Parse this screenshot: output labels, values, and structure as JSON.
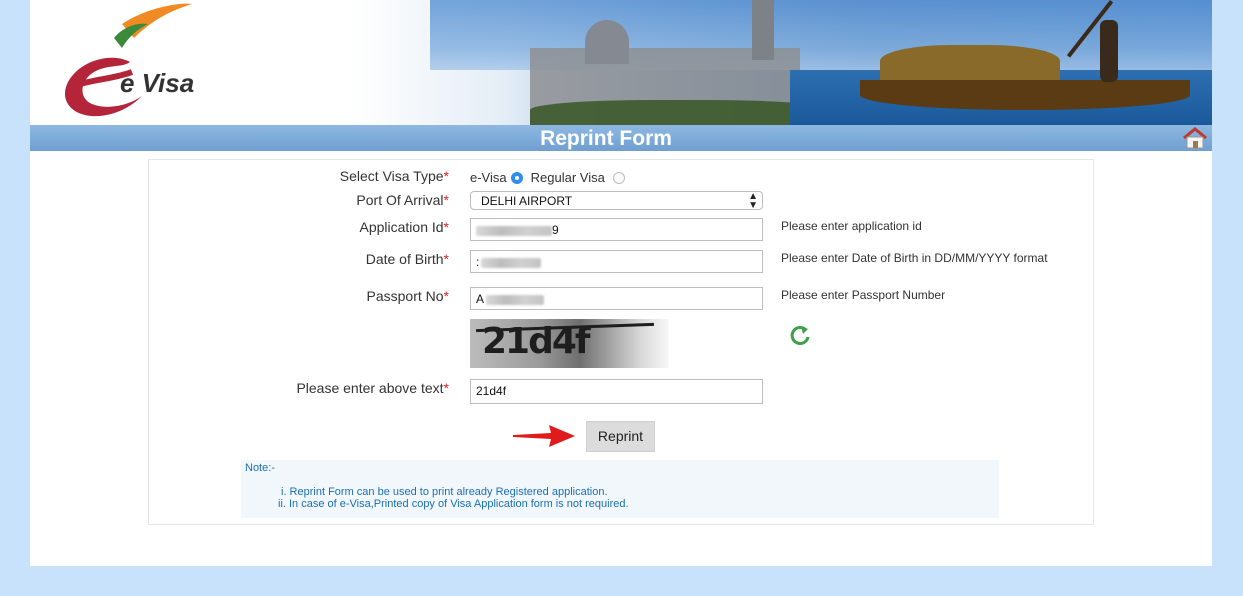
{
  "header": {
    "logo_text": "e Visa",
    "page_title": "Reprint Form"
  },
  "form": {
    "visa_type": {
      "label": "Select Visa Type",
      "required_mark": "*",
      "option_evisa": "e-Visa",
      "option_regular": "Regular Visa",
      "selected": "e-Visa"
    },
    "port_of_arrival": {
      "label": "Port Of Arrival",
      "required_mark": "*",
      "value": "DELHI AIRPORT"
    },
    "application_id": {
      "label": "Application Id",
      "required_mark": "*",
      "visible_value": "9",
      "hint": "Please enter application id"
    },
    "date_of_birth": {
      "label": "Date of Birth",
      "required_mark": "*",
      "visible_value": ":",
      "hint": "Please enter Date of Birth in DD/MM/YYYY format"
    },
    "passport_no": {
      "label": "Passport No",
      "required_mark": "*",
      "visible_value": "A",
      "hint": "Please enter Passport Number"
    },
    "captcha": {
      "image_text": "21d4f",
      "label": "Please enter above text",
      "required_mark": "*",
      "value": "21d4f"
    },
    "submit_label": "Reprint"
  },
  "note": {
    "title": "Note:-",
    "items": [
      "i. Reprint Form can be used to print already Registered application.",
      "ii. In case of e-Visa,Printed copy of Visa Application form is not required."
    ]
  },
  "colors": {
    "page_bg": "#c9e2fb",
    "title_bar": "#7aa9d8",
    "required": "#dd2222",
    "note_text": "#1a6fb5",
    "arrow": "#e01b1b",
    "refresh_icon": "#3aa14a"
  }
}
